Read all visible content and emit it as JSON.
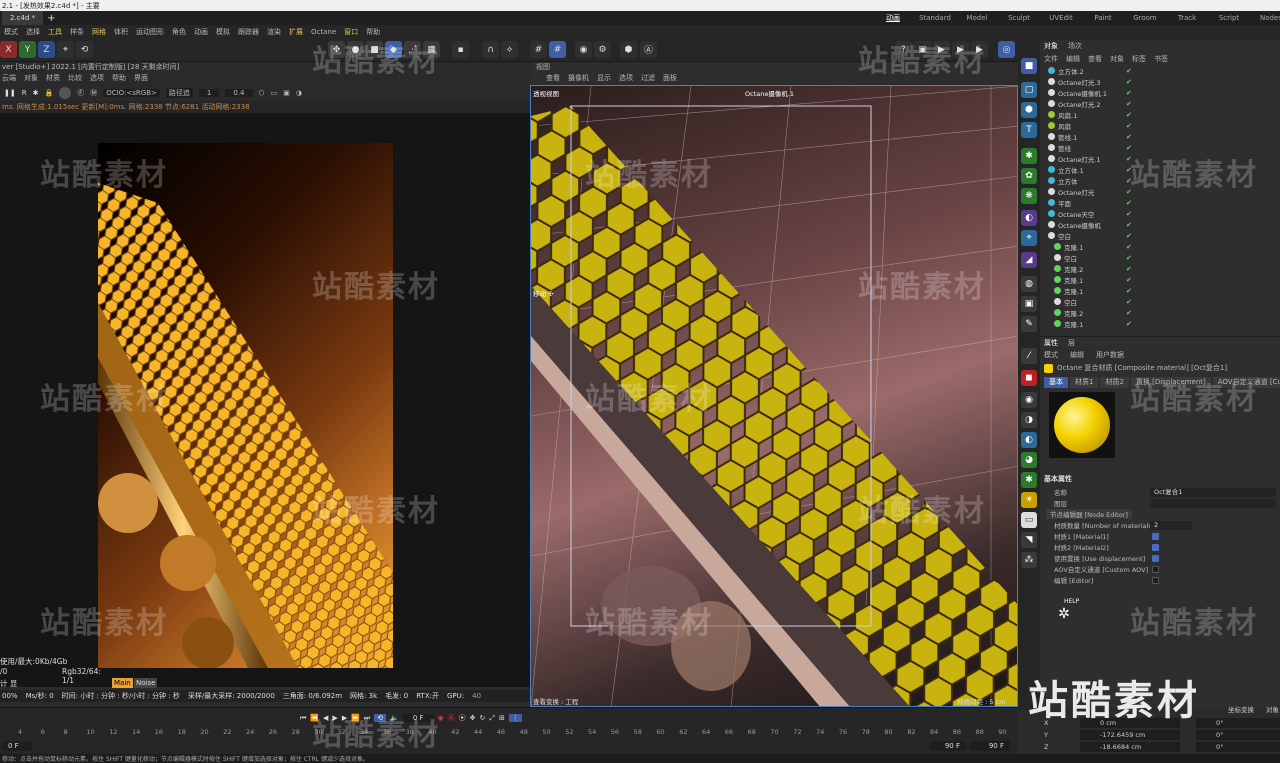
{
  "window": {
    "title": "2.1 - [发热效果2.c4d *] - 主要",
    "doc_tab": "2.c4d *",
    "add_tab": "+"
  },
  "layouts": [
    "动画",
    "Standard",
    "Model",
    "Sculpt",
    "UVEdit",
    "Paint",
    "Groom",
    "Track",
    "Script",
    "Nodes"
  ],
  "menubar": [
    "模式",
    "选择",
    "工具",
    "样条",
    "网格",
    "体积",
    "运动图形",
    "角色",
    "动画",
    "模拟",
    "跟踪器",
    "渲染",
    "扩展",
    "Octane",
    "窗口",
    "帮助"
  ],
  "axes": [
    "X",
    "Y",
    "Z"
  ],
  "left_panel": {
    "header": "ver [Studio+] 2022.1 [内置行定制版] [28 天剩余时间]",
    "menu": [
      "云端",
      "对象",
      "材质",
      "比较",
      "选项",
      "帮助",
      "界面"
    ],
    "ocio": "OCIO:<sRGB>",
    "path": "路径追",
    "val1": "1",
    "val2": "0.4",
    "stats_top": "ms. 网格生成:1.015sec 更新[M]:0ms. 网格:2338 节点:6281 活动网格:2338",
    "mem": "使用/最大:0Kb/4Gb",
    "rgb_left": "/0",
    "rgb": "Rgb32/64: 1/1",
    "vram": "计 显存:3.567Gb/5.583Gb/11.9",
    "main_badge": "Main",
    "noise_badge": "Noise",
    "status_row": [
      "00%",
      "Ms/秒: 0",
      "时间: 小时 : 分钟 : 秒/小时 : 分钟 : 秒",
      "采样/最大采样: 2000/2000",
      "三角面: 0/6.092m",
      "网格: 3k",
      "毛发: 0",
      "RTX:开",
      "GPU:",
      "40"
    ]
  },
  "viewport": {
    "menu_title": "视图",
    "menu": [
      "查看",
      "摄像机",
      "显示",
      "选项",
      "过滤",
      "面板"
    ],
    "view_label": "透视视图",
    "camera_label": "Octane摄像机.1",
    "move_label": "移动 ✣",
    "bottom_left": "查看变换 : 工程",
    "bottom_right": "网格间距 : 5 cm"
  },
  "object_panel": {
    "tabs": [
      "对象",
      "场次"
    ],
    "menu": [
      "文件",
      "编辑",
      "查看",
      "对象",
      "标签",
      "书签"
    ],
    "objects": [
      {
        "name": "立方体.2",
        "color": "#3fb8d9"
      },
      {
        "name": "Octane灯光.3",
        "color": "#dddddd"
      },
      {
        "name": "Octane摄像机.1",
        "color": "#dddddd"
      },
      {
        "name": "Octane灯光.2",
        "color": "#dddddd"
      },
      {
        "name": "风扇.1",
        "color": "#9acd32"
      },
      {
        "name": "风扇",
        "color": "#9acd32"
      },
      {
        "name": "管线.1",
        "color": "#dddddd"
      },
      {
        "name": "管线",
        "color": "#dddddd"
      },
      {
        "name": "Octane灯光.1",
        "color": "#dddddd"
      },
      {
        "name": "立方体.1",
        "color": "#3fb8d9"
      },
      {
        "name": "立方体",
        "color": "#3fb8d9"
      },
      {
        "name": "Octane灯光",
        "color": "#dddddd"
      },
      {
        "name": "平面",
        "color": "#3fb8d9"
      },
      {
        "name": "Octane天空",
        "color": "#3fb8d9"
      },
      {
        "name": "Octane摄像机",
        "color": "#dddddd"
      },
      {
        "name": "空白",
        "color": "#dddddd"
      },
      {
        "name": "克隆.1",
        "color": "#5cd65c"
      },
      {
        "name": "空白",
        "color": "#dddddd"
      },
      {
        "name": "克隆.2",
        "color": "#5cd65c"
      },
      {
        "name": "克隆.1",
        "color": "#5cd65c"
      },
      {
        "name": "克隆.1",
        "color": "#5cd65c"
      },
      {
        "name": "空白",
        "color": "#dddddd"
      },
      {
        "name": "克隆.2",
        "color": "#5cd65c"
      },
      {
        "name": "克隆.1",
        "color": "#5cd65c"
      }
    ]
  },
  "attr_panel": {
    "tabs": [
      "属性",
      "层"
    ],
    "menu": [
      "模式",
      "编辑",
      "用户数据"
    ],
    "material_title": "Octane 复合材质 [Composite material] [Oct复合1]",
    "subtabs": [
      "基本",
      "材质1",
      "材质2",
      "置换 [Displacement]",
      "AOV自定义通道 [Custom A"
    ],
    "section": "基本属性",
    "fields": [
      {
        "label": "名称",
        "value": "Oct复合1",
        "kind": "text"
      },
      {
        "label": "图层",
        "value": "",
        "kind": "text"
      },
      {
        "label": "节点编辑器 [Node Editor]",
        "value": "",
        "kind": "button"
      },
      {
        "label": "材质数量 [Number of materials]",
        "value": "2",
        "kind": "text"
      },
      {
        "label": "材质1 [Material1]",
        "value": "on",
        "kind": "check"
      },
      {
        "label": "材质2 [Material2]",
        "value": "on",
        "kind": "check"
      },
      {
        "label": "使用置换 [Use displacement]",
        "value": "on",
        "kind": "check"
      },
      {
        "label": "AOV自定义通道 [Custom AOV]",
        "value": "off",
        "kind": "check"
      },
      {
        "label": "编辑 [Editor]",
        "value": "off",
        "kind": "check"
      }
    ],
    "help_label": "HELP"
  },
  "timeline": {
    "ticks": [
      "4",
      "6",
      "8",
      "10",
      "12",
      "14",
      "16",
      "18",
      "20",
      "22",
      "24",
      "26",
      "28",
      "30",
      "32",
      "34",
      "36",
      "38",
      "40",
      "42",
      "44",
      "46",
      "48",
      "50",
      "52",
      "54",
      "56",
      "58",
      "60",
      "62",
      "64",
      "66",
      "68",
      "70",
      "72",
      "74",
      "76",
      "78",
      "80",
      "82",
      "84",
      "86",
      "88",
      "90"
    ],
    "current_frame": "0 F",
    "start_frame": "0 F",
    "end_frame_a": "90 F",
    "end_frame_b": "90 F",
    "coord_tab1": "坐标变换",
    "coord_tab2": "对象",
    "coords": [
      {
        "axis": "X",
        "pos": "0 cm",
        "rot": "0°"
      },
      {
        "axis": "Y",
        "pos": "-172.6459 cm",
        "rot": "0°"
      },
      {
        "axis": "Z",
        "pos": "-18.6684 cm",
        "rot": "0°"
      }
    ]
  },
  "status_text": "移动：点击并拖动鼠标移动元素。按住 SHIFT 键量化移动；节点编辑器模式时按住 SHIFT 键增加选择对象；按住 CTRL 键减少选择对象。",
  "watermark": "站酷素材"
}
